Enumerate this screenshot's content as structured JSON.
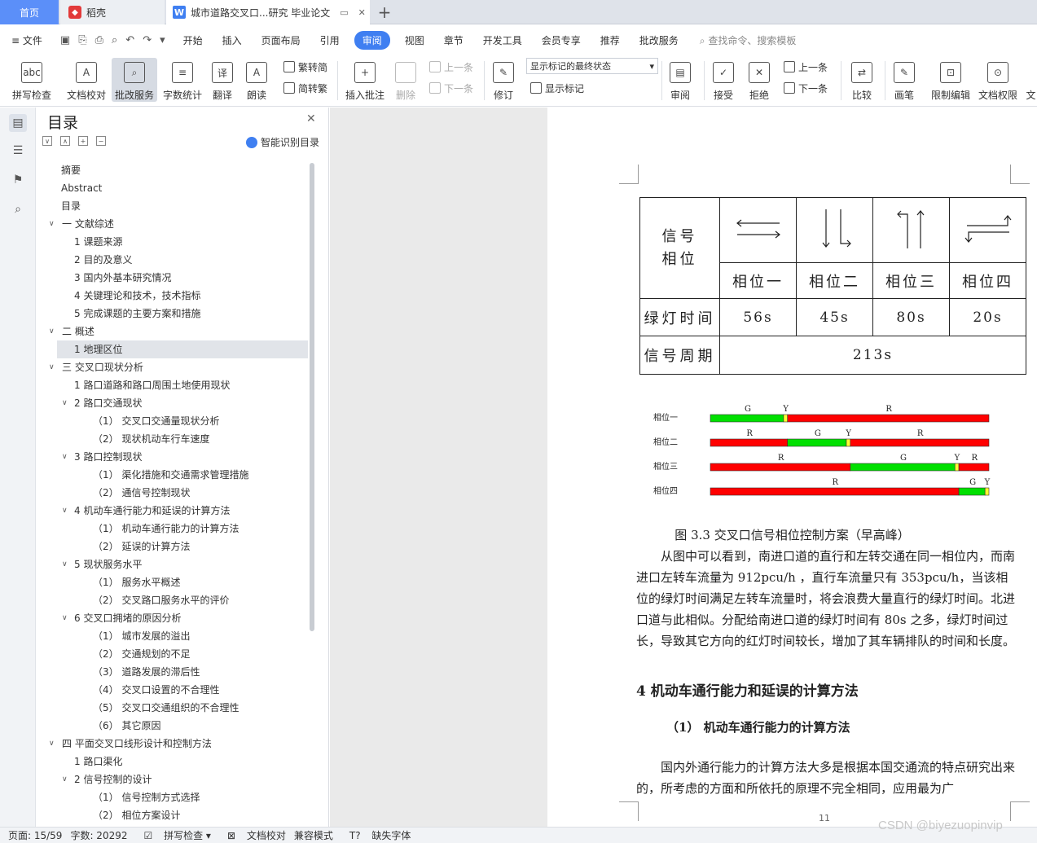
{
  "tabs": {
    "home": "首页",
    "daoke": "稻壳",
    "doc": "城市道路交叉口...研究 毕业论文",
    "add": "+"
  },
  "menu": {
    "file": "文件",
    "items": [
      "开始",
      "插入",
      "页面布局",
      "引用",
      "审阅",
      "视图",
      "章节",
      "开发工具",
      "会员专享",
      "推荐",
      "批改服务"
    ],
    "active": "审阅",
    "search": "查找命令、搜索模板"
  },
  "ribbon": {
    "spell": "拼写检查",
    "doccheck": "文档校对",
    "review_service": "批改服务",
    "wordcount": "字数统计",
    "translate": "翻译",
    "read": "朗读",
    "trad": "繁转简",
    "simp": "简转繁",
    "insert_comment": "插入批注",
    "delete": "删除",
    "prev": "上一条",
    "next": "下一条",
    "track": "修订",
    "markup_state": "显示标记的最终状态",
    "show_markup": "显示标记",
    "review": "审阅",
    "accept": "接受",
    "reject": "拒绝",
    "prev2": "上一条",
    "next2": "下一条",
    "compare": "比较",
    "pen": "画笔",
    "restrict": "限制编辑",
    "rights": "文档权限",
    "more": "文"
  },
  "toc": {
    "title": "目录",
    "ai": "智能识别目录",
    "items": [
      {
        "label": "摘要",
        "level": 0
      },
      {
        "label": "Abstract",
        "level": 0
      },
      {
        "label": "目录",
        "level": 0
      },
      {
        "label": "一  文献综述",
        "level": 1,
        "arrow": true
      },
      {
        "label": "1  课题来源",
        "level": 2
      },
      {
        "label": "2  目的及意义",
        "level": 2
      },
      {
        "label": "3  国内外基本研究情况",
        "level": 2
      },
      {
        "label": "4  关键理论和技术，技术指标",
        "level": 2
      },
      {
        "label": "5  完成课题的主要方案和措施",
        "level": 2
      },
      {
        "label": "二  概述",
        "level": 1,
        "arrow": true
      },
      {
        "label": "1  地理区位",
        "level": 2,
        "selected": true
      },
      {
        "label": "三  交叉口现状分析",
        "level": 1,
        "arrow": true
      },
      {
        "label": "1  路口道路和路口周围土地使用现状",
        "level": 2
      },
      {
        "label": "2  路口交通现状",
        "level": 2,
        "arrow": true
      },
      {
        "label": "（1）  交叉口交通量现状分析",
        "level": 3
      },
      {
        "label": "（2）  现状机动车行车速度",
        "level": 3
      },
      {
        "label": "3  路口控制现状",
        "level": 2,
        "arrow": true
      },
      {
        "label": "（1）  渠化措施和交通需求管理措施",
        "level": 3
      },
      {
        "label": "（2）  通信号控制现状",
        "level": 3
      },
      {
        "label": "4  机动车通行能力和延误的计算方法",
        "level": 2,
        "arrow": true
      },
      {
        "label": "（1）  机动车通行能力的计算方法",
        "level": 3
      },
      {
        "label": "（2）  延误的计算方法",
        "level": 3
      },
      {
        "label": "5  现状服务水平",
        "level": 2,
        "arrow": true
      },
      {
        "label": "（1）  服务水平概述",
        "level": 3
      },
      {
        "label": "（2）  交叉路口服务水平的评价",
        "level": 3
      },
      {
        "label": "6  交叉口拥堵的原因分析",
        "level": 2,
        "arrow": true
      },
      {
        "label": "（1）  城市发展的溢出",
        "level": 3
      },
      {
        "label": "（2）  交通规划的不足",
        "level": 3
      },
      {
        "label": "（3）  道路发展的滞后性",
        "level": 3
      },
      {
        "label": "（4）  交叉口设置的不合理性",
        "level": 3
      },
      {
        "label": "（5）  交叉口交通组织的不合理性",
        "level": 3
      },
      {
        "label": "（6）  其它原因",
        "level": 3
      },
      {
        "label": "四  平面交叉口线形设计和控制方法",
        "level": 1,
        "arrow": true
      },
      {
        "label": "1  路口渠化",
        "level": 2
      },
      {
        "label": "2  信号控制的设计",
        "level": 2,
        "arrow": true
      },
      {
        "label": "（1）  信号控制方式选择",
        "level": 3
      },
      {
        "label": "（2）  相位方案设计",
        "level": 3
      }
    ]
  },
  "doc": {
    "table": {
      "phase_label": "信号\n相位",
      "phases": [
        "相位一",
        "相位二",
        "相位三",
        "相位四"
      ],
      "green_label": "绿灯时间",
      "green_times": [
        "56s",
        "45s",
        "80s",
        "20s"
      ],
      "cycle_label": "信号周期",
      "cycle": "213s"
    },
    "timing_chart": {
      "rows": [
        {
          "label": "相位一",
          "segments": [
            {
              "color": "G",
              "len": 56
            },
            {
              "color": "Y",
              "len": 3
            },
            {
              "color": "R",
              "len": 154
            }
          ]
        },
        {
          "label": "相位二",
          "segments": [
            {
              "color": "R",
              "len": 59
            },
            {
              "color": "G",
              "len": 45
            },
            {
              "color": "Y",
              "len": 3
            },
            {
              "color": "R",
              "len": 106
            }
          ]
        },
        {
          "label": "相位三",
          "segments": [
            {
              "color": "R",
              "len": 107
            },
            {
              "color": "G",
              "len": 80
            },
            {
              "color": "Y",
              "len": 3
            },
            {
              "color": "R",
              "len": 23
            }
          ]
        },
        {
          "label": "相位四",
          "segments": [
            {
              "color": "R",
              "len": 190
            },
            {
              "color": "G",
              "len": 20
            },
            {
              "color": "Y",
              "len": 3
            }
          ]
        }
      ],
      "colors": {
        "R": "#ff0000",
        "G": "#00e000",
        "Y": "#ffff33"
      }
    },
    "caption": "图 3.3   交叉口信号相位控制方案（早高峰）",
    "para1": "从图中可以看到，南进口道的直行和左转交通在同一相位内，而南进口左转车流量为 912pcu/h ，直行车流量只有 353pcu/h，当该相位的绿灯时间满足左转车流量时，将会浪费大量直行的绿灯时间。北进口道与此相似。分配给南进口道的绿灯时间有 80s 之多，绿灯时间过长，导致其它方向的红灯时间较长，增加了其车辆排队的时间和长度。",
    "h2": "4  机动车通行能力和延误的计算方法",
    "h3": "（1）   机动车通行能力的计算方法",
    "para2": "国内外通行能力的计算方法大多是根据本国交通流的特点研究出来的，所考虑的方面和所依托的原理不完全相同，应用最为广",
    "page_number": "11"
  },
  "status": {
    "page": "页面: 15/59",
    "words": "字数: 20292",
    "spell": "拼写检查",
    "doccheck": "文档校对",
    "compat": "兼容模式",
    "missing_font": "缺失字体"
  },
  "watermark": "CSDN @biyezuopinvip"
}
